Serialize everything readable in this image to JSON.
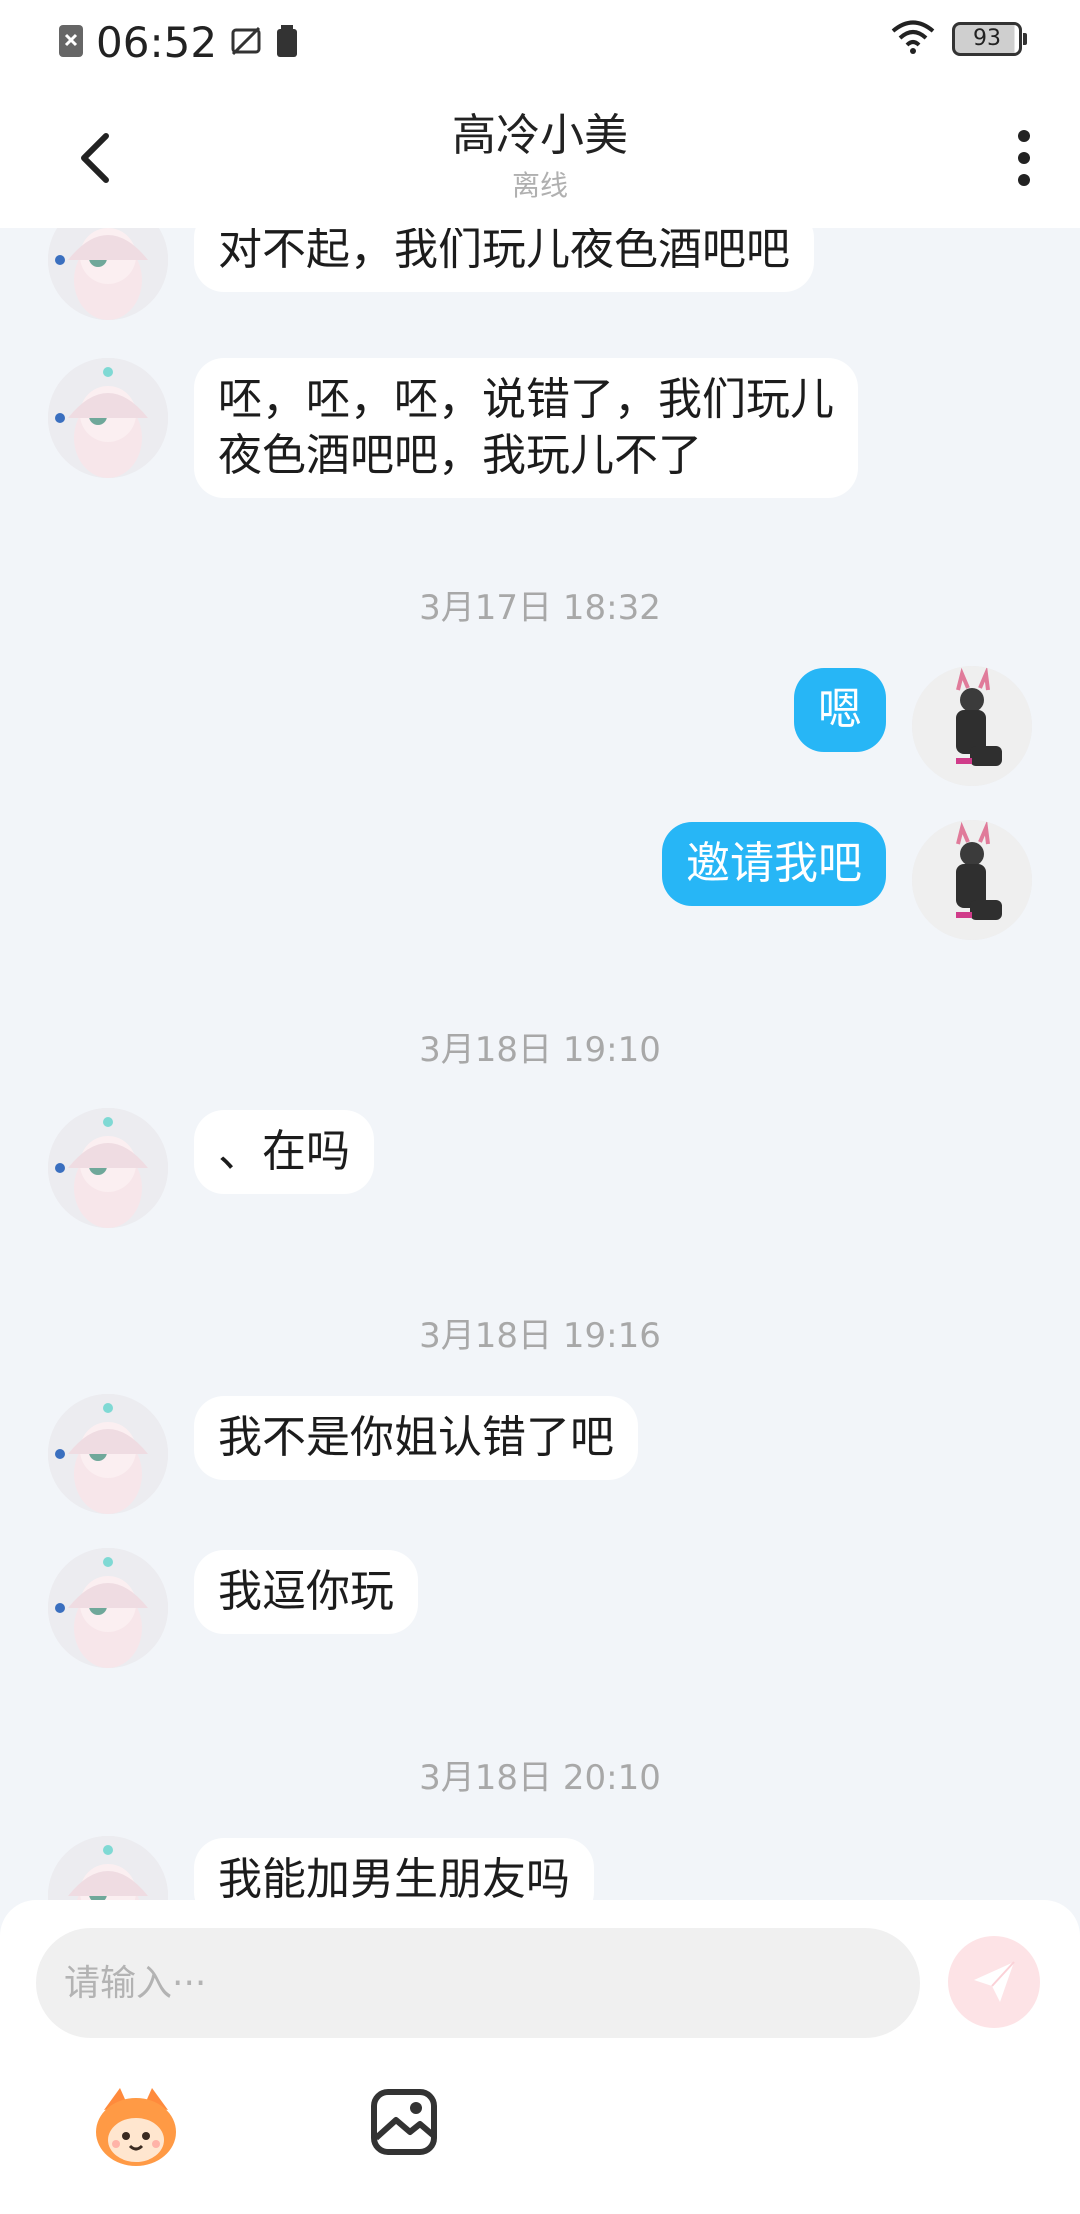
{
  "status_bar": {
    "time": "06:52",
    "battery": "93"
  },
  "header": {
    "title": "高冷小美",
    "subtitle": "离线"
  },
  "messages": [
    {
      "side": "in",
      "text": "对不起，我们玩儿夜色酒吧吧"
    },
    {
      "side": "in",
      "line1": "呸，呸，呸，说错了，我们玩儿",
      "line2": "夜色酒吧吧，我玩儿不了"
    },
    {
      "type": "time",
      "text": "3月17日 18:32"
    },
    {
      "side": "out",
      "text": "嗯"
    },
    {
      "side": "out",
      "text": "邀请我吧"
    },
    {
      "type": "time",
      "text": "3月18日 19:10"
    },
    {
      "side": "in",
      "text": "、在吗"
    },
    {
      "type": "time",
      "text": "3月18日 19:16"
    },
    {
      "side": "in",
      "text": "我不是你姐认错了吧"
    },
    {
      "side": "in",
      "text": "我逗你玩"
    },
    {
      "type": "time",
      "text": "3月18日 20:10"
    },
    {
      "side": "in",
      "text": "我能加男生朋友吗"
    }
  ],
  "input": {
    "placeholder": "请输入···"
  },
  "colors": {
    "accent": "#27b6f6",
    "background": "#f2f5f9",
    "send_disabled": "#fde3e6"
  },
  "icons": {
    "back": "back-arrow-icon",
    "more": "more-vertical-icon",
    "send": "paper-plane-icon",
    "emoji": "emoji-mascot-icon",
    "image": "image-icon"
  }
}
